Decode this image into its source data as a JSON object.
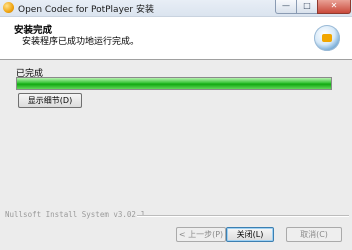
{
  "window": {
    "title": "Open Codec for PotPlayer 安装",
    "controls": {
      "minimize": "—",
      "maximize": "□",
      "close": "✕"
    }
  },
  "header": {
    "title": "安装完成",
    "subtitle": "安装程序已成功地运行完成。"
  },
  "body": {
    "status": "已完成",
    "progress_percent": 100,
    "details_button": "显示细节(D)"
  },
  "footer": {
    "branding": "Nullsoft Install System v3.02.1",
    "back_button": "< 上一步(P)",
    "close_button": "关闭(L)",
    "cancel_button": "取消(C)"
  },
  "colors": {
    "progress": "#18b018",
    "titlebar": "#dbe4ef",
    "dialog_bg": "#ececec"
  }
}
